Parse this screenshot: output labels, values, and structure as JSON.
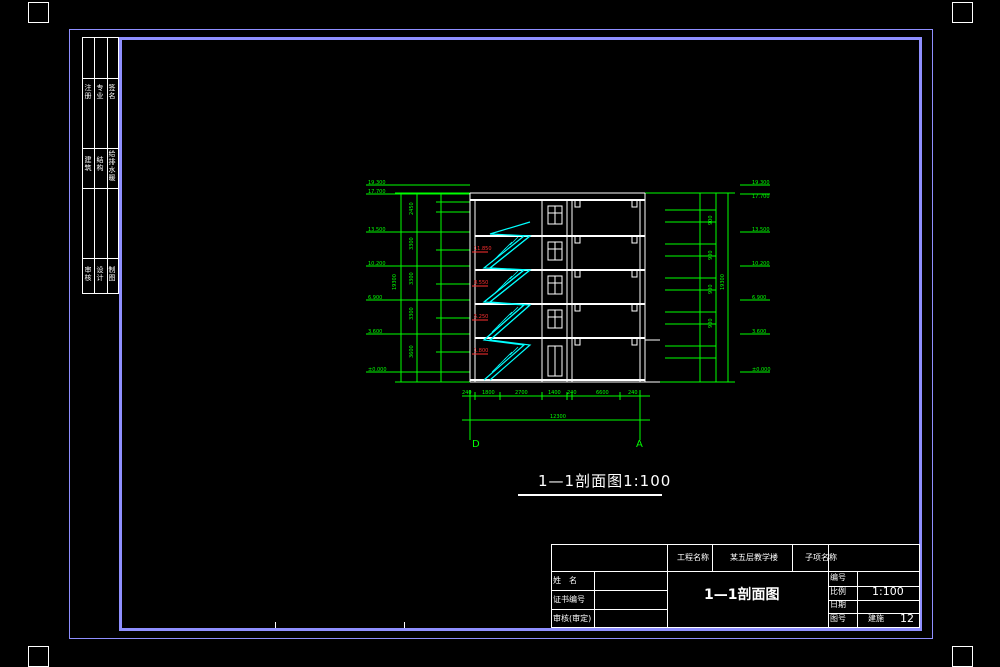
{
  "drawing": {
    "title": "1—1剖面图1:100",
    "axis_left": "D",
    "axis_right": "A"
  },
  "left_strip": {
    "group1": [
      "注册",
      "专业",
      "签名"
    ],
    "group2": [
      "建筑",
      "结构",
      "给排水暖"
    ],
    "group3": [
      "审核",
      "设计",
      "制图"
    ]
  },
  "title_block": {
    "project_label": "工程名称",
    "project_value": "某五层教学楼",
    "subitem_label": "子项名称",
    "name_label": "姓　名",
    "cert_label": "证书编号",
    "review_label": "审核(审定)",
    "drawing_name": "1—1剖面图",
    "no_label": "编号",
    "scale_label": "比例",
    "scale_value": "1:100",
    "date_label": "日期",
    "sheet_label": "图号",
    "sheet_value_prefix": "建施",
    "sheet_value": "12"
  },
  "colors": {
    "frame": "#8f8fff",
    "dim_green": "#00ff00",
    "stair_cyan": "#00ffff",
    "building_white": "#ffffff",
    "level_red": "#ff3030"
  }
}
